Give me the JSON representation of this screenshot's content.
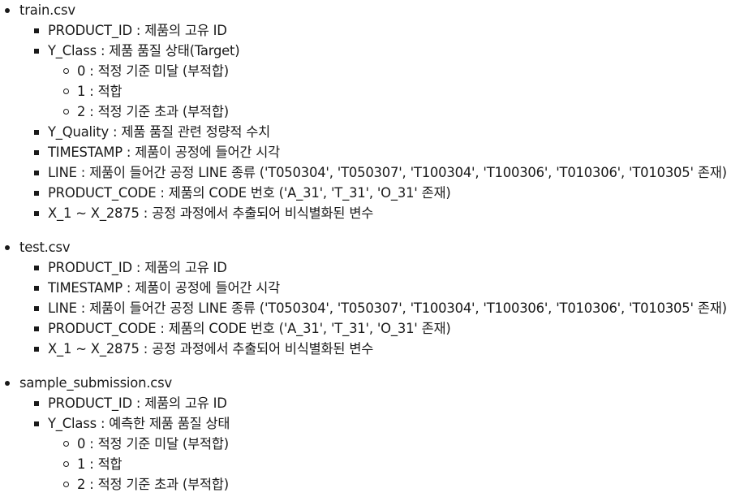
{
  "files": [
    {
      "name": "train.csv",
      "fields": [
        {
          "label": "PRODUCT_ID : 제품의 고유 ID"
        },
        {
          "label": "Y_Class : 제품 품질 상태(Target)",
          "values": [
            "0 : 적정 기준 미달 (부적합)",
            "1 : 적합",
            "2 : 적정 기준 초과 (부적합)"
          ]
        },
        {
          "label": "Y_Quality : 제품 품질 관련 정량적 수치"
        },
        {
          "label": "TIMESTAMP : 제품이 공정에 들어간 시각"
        },
        {
          "label": "LINE : 제품이 들어간 공정 LINE 종류 ('T050304', 'T050307', 'T100304', 'T100306', 'T010306', 'T010305' 존재)"
        },
        {
          "label": "PRODUCT_CODE : 제품의 CODE 번호 ('A_31', 'T_31', 'O_31' 존재)"
        },
        {
          "label": "X_1 ~ X_2875 : 공정 과정에서 추출되어 비식별화된 변수"
        }
      ]
    },
    {
      "name": "test.csv",
      "fields": [
        {
          "label": "PRODUCT_ID : 제품의 고유 ID"
        },
        {
          "label": "TIMESTAMP : 제품이 공정에 들어간 시각"
        },
        {
          "label": "LINE : 제품이 들어간 공정 LINE 종류 ('T050304', 'T050307', 'T100304', 'T100306', 'T010306', 'T010305' 존재)"
        },
        {
          "label": "PRODUCT_CODE : 제품의 CODE 번호 ('A_31', 'T_31', 'O_31' 존재)"
        },
        {
          "label": "X_1 ~ X_2875 : 공정 과정에서 추출되어 비식별화된 변수"
        }
      ]
    },
    {
      "name": "sample_submission.csv",
      "fields": [
        {
          "label": "PRODUCT_ID : 제품의 고유 ID"
        },
        {
          "label": "Y_Class : 예측한 제품 품질 상태",
          "values": [
            "0 : 적정 기준 미달 (부적합)",
            "1 : 적합",
            "2 : 적정 기준 초과 (부적합)"
          ]
        }
      ]
    }
  ]
}
